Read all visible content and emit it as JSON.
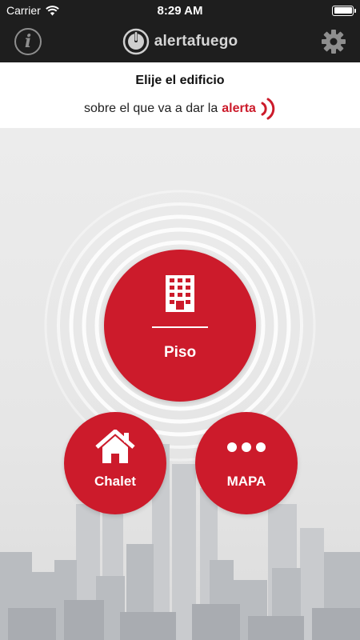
{
  "status_bar": {
    "carrier": "Carrier",
    "time": "8:29 AM",
    "battery_level": 1.0
  },
  "nav": {
    "brand": "alertafuego",
    "info_icon": "info-icon",
    "settings_icon": "gear-icon"
  },
  "header": {
    "line1": "Elije el edificio",
    "line2_prefix": "sobre el que va a dar la",
    "line2_highlight": "alerta"
  },
  "buttons": {
    "piso": {
      "label": "Piso",
      "icon": "building-icon"
    },
    "chalet": {
      "label": "Chalet",
      "icon": "house-icon"
    },
    "mapa": {
      "label": "MAPA",
      "icon": "more-dots-icon"
    }
  },
  "colors": {
    "accent": "#cc1b2b",
    "bar_bg": "#1e1e1e"
  }
}
